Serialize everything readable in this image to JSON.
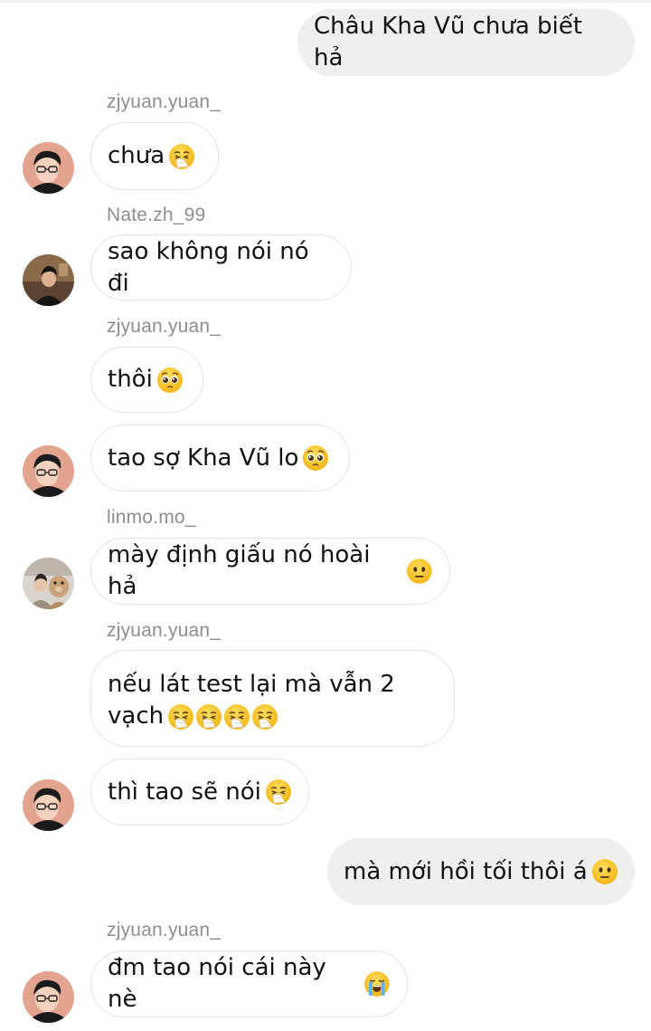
{
  "messages": [
    {
      "id": "m1",
      "sender": "me",
      "text": "Châu Kha Vũ chưa biết hả"
    },
    {
      "id": "m2",
      "username": "zjyuan.yuan_",
      "text": "chưa",
      "emoji": [
        "sneezing-face-emoji"
      ]
    },
    {
      "id": "m3",
      "username": "Nate.zh_99",
      "text": "sao không nói nó đi"
    },
    {
      "id": "m4",
      "username": "zjyuan.yuan_",
      "text": "thôi",
      "emoji": [
        "pleading-face-emoji"
      ]
    },
    {
      "id": "m5",
      "text": "tao sợ Kha Vũ lo",
      "emoji": [
        "pleading-face-emoji"
      ]
    },
    {
      "id": "m6",
      "username": "linmo.mo_",
      "text": "mày định giấu nó hoài hả",
      "emoji": [
        "neutral-face-emoji"
      ]
    },
    {
      "id": "m7",
      "username": "zjyuan.yuan_",
      "line1": "nếu lát test lại mà vẫn 2",
      "line2": "vạch",
      "emoji": [
        "sneezing-face-emoji",
        "sneezing-face-emoji",
        "sneezing-face-emoji",
        "sneezing-face-emoji"
      ]
    },
    {
      "id": "m8",
      "text": "thì tao sẽ nói",
      "emoji": [
        "sneezing-face-emoji"
      ]
    },
    {
      "id": "m9",
      "sender": "me",
      "text": "mà mới hồi tối thôi á",
      "emoji": [
        "neutral-face-emoji"
      ]
    },
    {
      "id": "m10",
      "username": "zjyuan.yuan_",
      "text": "đm tao nói cái này nè",
      "emoji": [
        "crying-face-emoji"
      ]
    }
  ],
  "colors": {
    "outgoing_bubble": "#efefef",
    "incoming_border": "#e3e3e3",
    "username": "#8e8e8e",
    "emoji_yellow": "#f7c02a"
  }
}
